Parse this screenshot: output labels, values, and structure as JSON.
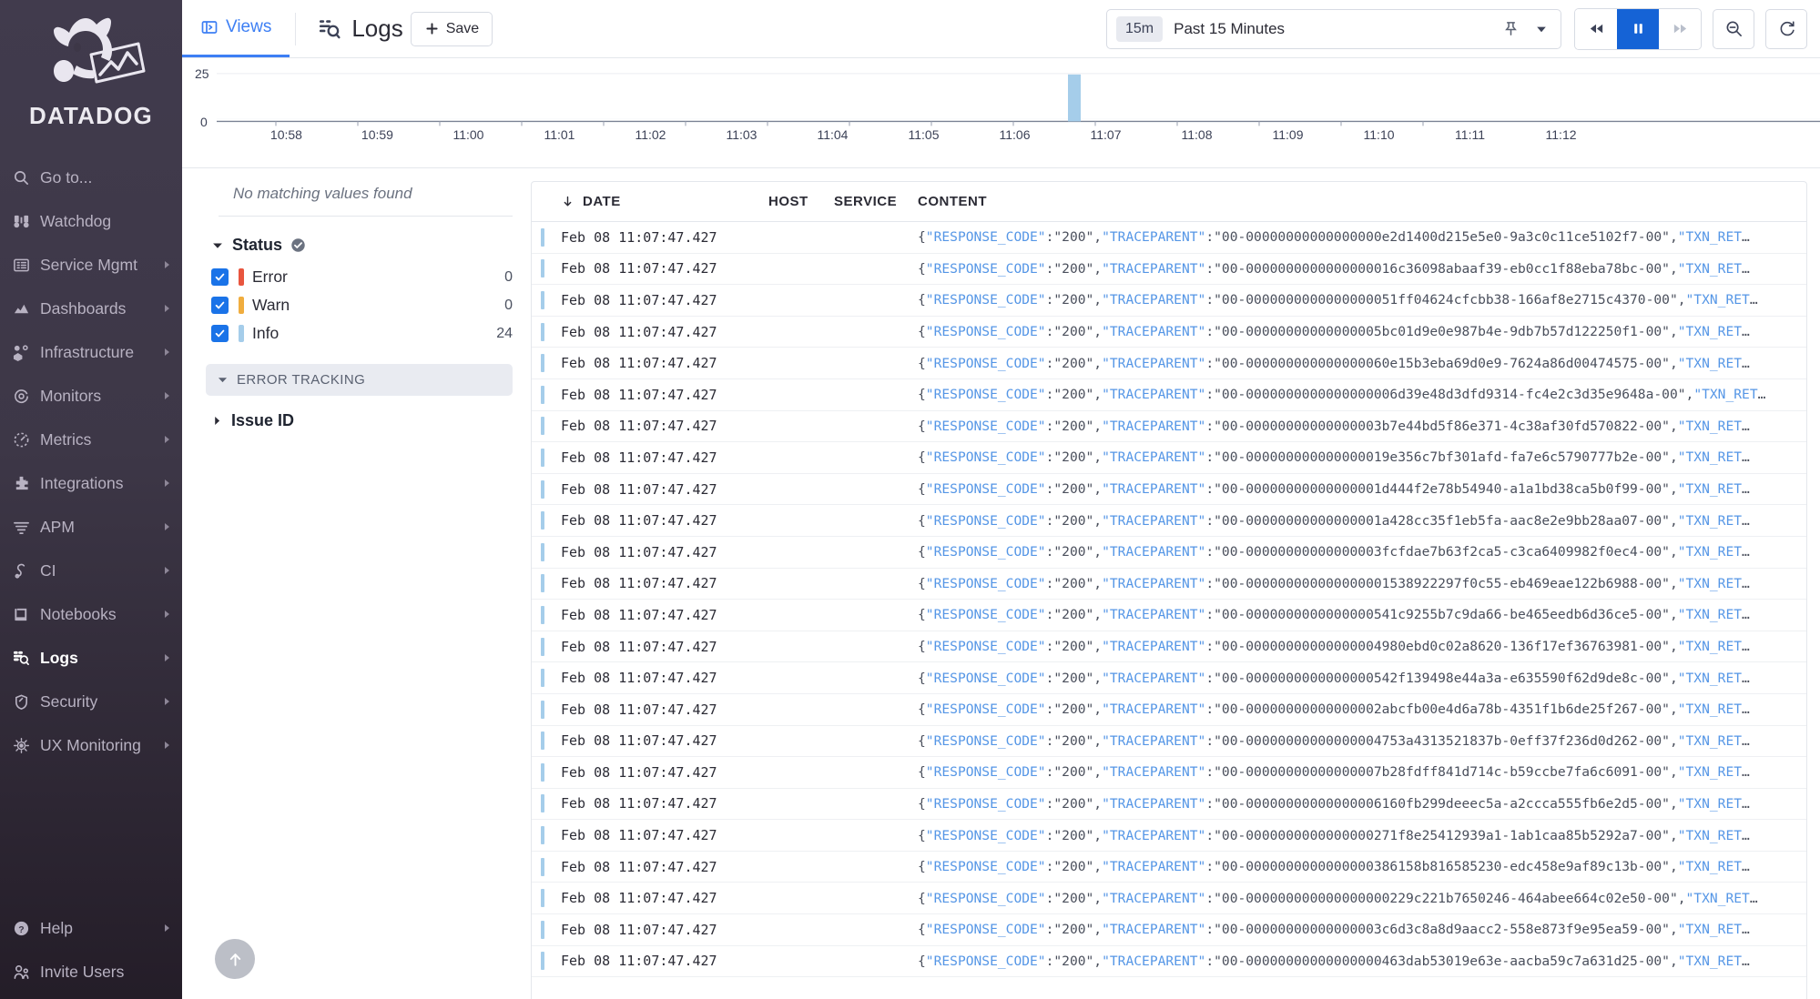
{
  "sidebar": {
    "brand": "DATADOG",
    "items": [
      {
        "label": "Go to...",
        "icon": "search-icon",
        "caret": false,
        "active": false
      },
      {
        "label": "Watchdog",
        "icon": "binoculars-icon",
        "caret": false,
        "active": false
      },
      {
        "label": "Service Mgmt",
        "icon": "list-icon",
        "caret": true,
        "active": false
      },
      {
        "label": "Dashboards",
        "icon": "chart-area-icon",
        "caret": true,
        "active": false
      },
      {
        "label": "Infrastructure",
        "icon": "nodes-icon",
        "caret": true,
        "active": false
      },
      {
        "label": "Monitors",
        "icon": "target-icon",
        "caret": true,
        "active": false
      },
      {
        "label": "Metrics",
        "icon": "gauge-icon",
        "caret": true,
        "active": false
      },
      {
        "label": "Integrations",
        "icon": "puzzle-icon",
        "caret": true,
        "active": false
      },
      {
        "label": "APM",
        "icon": "filter-lines-icon",
        "caret": true,
        "active": false
      },
      {
        "label": "CI",
        "icon": "pipeline-icon",
        "caret": true,
        "active": false
      },
      {
        "label": "Notebooks",
        "icon": "notebook-icon",
        "caret": true,
        "active": false
      },
      {
        "label": "Logs",
        "icon": "logs-search-icon",
        "caret": true,
        "active": true
      },
      {
        "label": "Security",
        "icon": "shield-icon",
        "caret": true,
        "active": false
      },
      {
        "label": "UX Monitoring",
        "icon": "ux-globe-icon",
        "caret": true,
        "active": false
      }
    ],
    "bottom_items": [
      {
        "label": "Help",
        "icon": "help-icon",
        "caret": true,
        "active": false
      },
      {
        "label": "Invite Users",
        "icon": "invite-users-icon",
        "caret": false,
        "active": false
      }
    ]
  },
  "topbar": {
    "views_tab": "Views",
    "page_title": "Logs",
    "save_label": "Save",
    "time_badge": "15m",
    "time_label": "Past 15 Minutes",
    "playback": {
      "rewind": "rewind-icon",
      "pause": "pause-icon",
      "forward": "forward-icon",
      "active": "pause"
    },
    "zoom_out": "zoom-out-icon",
    "refresh": "refresh-icon",
    "pin": "pin-icon",
    "chevron": "chevron-down-icon"
  },
  "facets": {
    "no_match_text": "No matching values found",
    "status": {
      "title": "Status",
      "badge": "check-circle-icon",
      "expanded": true,
      "values": [
        {
          "label": "Error",
          "count": "0",
          "color": "#e8553e",
          "checked": true
        },
        {
          "label": "Warn",
          "count": "0",
          "color": "#f0ad3e",
          "checked": true
        },
        {
          "label": "Info",
          "count": "24",
          "color": "#a5cdea",
          "checked": true
        }
      ]
    },
    "group": {
      "label": "ERROR TRACKING",
      "expanded": true
    },
    "issue_id": {
      "label": "Issue ID",
      "expanded": false
    },
    "scroll_top": "arrow-up-icon"
  },
  "table": {
    "columns": [
      "DATE",
      "HOST",
      "SERVICE",
      "CONTENT"
    ],
    "sort_icon": "sort-desc-arrow-icon",
    "rows": [
      {
        "date": "Feb 08 11:07:47.427",
        "host": "",
        "service": "",
        "status_color": "#a5cdea",
        "trace": "00-00000000000000000e2d1400d215e5e0-9a3c0c11ce5102f7-00"
      },
      {
        "date": "Feb 08 11:07:47.427",
        "host": "",
        "service": "",
        "status_color": "#a5cdea",
        "trace": "00-0000000000000000016c36098abaaf39-eb0cc1f88eba78bc-00"
      },
      {
        "date": "Feb 08 11:07:47.427",
        "host": "",
        "service": "",
        "status_color": "#a5cdea",
        "trace": "00-0000000000000000051ff04624cfcbb38-166af8e2715c4370-00"
      },
      {
        "date": "Feb 08 11:07:47.427",
        "host": "",
        "service": "",
        "status_color": "#a5cdea",
        "trace": "00-00000000000000005bc01d9e0e987b4e-9db7b57d122250f1-00"
      },
      {
        "date": "Feb 08 11:07:47.427",
        "host": "",
        "service": "",
        "status_color": "#a5cdea",
        "trace": "00-000000000000000060e15b3eba69d0e9-7624a86d00474575-00"
      },
      {
        "date": "Feb 08 11:07:47.427",
        "host": "",
        "service": "",
        "status_color": "#a5cdea",
        "trace": "00-0000000000000000006d39e48d3dfd9314-fc4e2c3d35e9648a-00"
      },
      {
        "date": "Feb 08 11:07:47.427",
        "host": "",
        "service": "",
        "status_color": "#a5cdea",
        "trace": "00-00000000000000003b7e44bd5f86e371-4c38af30fd570822-00"
      },
      {
        "date": "Feb 08 11:07:47.427",
        "host": "",
        "service": "",
        "status_color": "#a5cdea",
        "trace": "00-000000000000000019e356c7bf301afd-fa7e6c5790777b2e-00"
      },
      {
        "date": "Feb 08 11:07:47.427",
        "host": "",
        "service": "",
        "status_color": "#a5cdea",
        "trace": "00-00000000000000001d444f2e78b54940-a1a1bd38ca5b0f99-00"
      },
      {
        "date": "Feb 08 11:07:47.427",
        "host": "",
        "service": "",
        "status_color": "#a5cdea",
        "trace": "00-00000000000000001a428cc35f1eb5fa-aac8e2e9bb28aa07-00"
      },
      {
        "date": "Feb 08 11:07:47.427",
        "host": "",
        "service": "",
        "status_color": "#a5cdea",
        "trace": "00-00000000000000003fcfdae7b63f2ca5-c3ca6409982f0ec4-00"
      },
      {
        "date": "Feb 08 11:07:47.427",
        "host": "",
        "service": "",
        "status_color": "#a5cdea",
        "trace": "00-000000000000000001538922297f0c55-eb469eae122b6988-00"
      },
      {
        "date": "Feb 08 11:07:47.427",
        "host": "",
        "service": "",
        "status_color": "#a5cdea",
        "trace": "00-0000000000000000541c9255b7c9da66-be465eedb6d36ce5-00"
      },
      {
        "date": "Feb 08 11:07:47.427",
        "host": "",
        "service": "",
        "status_color": "#a5cdea",
        "trace": "00-00000000000000004980ebd0c02a8620-136f17ef36763981-00"
      },
      {
        "date": "Feb 08 11:07:47.427",
        "host": "",
        "service": "",
        "status_color": "#a5cdea",
        "trace": "00-0000000000000000542f139498e44a3a-e635590f62d9de8c-00"
      },
      {
        "date": "Feb 08 11:07:47.427",
        "host": "",
        "service": "",
        "status_color": "#a5cdea",
        "trace": "00-00000000000000002abcfb00e4d6a78b-4351f1b6de25f267-00"
      },
      {
        "date": "Feb 08 11:07:47.427",
        "host": "",
        "service": "",
        "status_color": "#a5cdea",
        "trace": "00-00000000000000004753a4313521837b-0eff37f236d0d262-00"
      },
      {
        "date": "Feb 08 11:07:47.427",
        "host": "",
        "service": "",
        "status_color": "#a5cdea",
        "trace": "00-00000000000000007b28fdff841d714c-b59ccbe7fa6c6091-00"
      },
      {
        "date": "Feb 08 11:07:47.427",
        "host": "",
        "service": "",
        "status_color": "#a5cdea",
        "trace": "00-00000000000000006160fb299deeec5a-a2ccca555fb6e2d5-00"
      },
      {
        "date": "Feb 08 11:07:47.427",
        "host": "",
        "service": "",
        "status_color": "#a5cdea",
        "trace": "00-0000000000000000271f8e25412939a1-1ab1caa85b5292a7-00"
      },
      {
        "date": "Feb 08 11:07:47.427",
        "host": "",
        "service": "",
        "status_color": "#a5cdea",
        "trace": "00-0000000000000000386158b816585230-edc458e9af89c13b-00"
      },
      {
        "date": "Feb 08 11:07:47.427",
        "host": "",
        "service": "",
        "status_color": "#a5cdea",
        "trace": "00-000000000000000000229c221b7650246-464abee664c02e50-00"
      },
      {
        "date": "Feb 08 11:07:47.427",
        "host": "",
        "service": "",
        "status_color": "#a5cdea",
        "trace": "00-00000000000000003c6d3c8a8d9aacc2-558e873f9e95ea59-00"
      },
      {
        "date": "Feb 08 11:07:47.427",
        "host": "",
        "service": "",
        "status_color": "#a5cdea",
        "trace": "00-00000000000000000463dab53019e63e-aacba59c7a631d25-00"
      }
    ],
    "content_prefix_key": "RESPONSE_CODE",
    "content_code_value": "200",
    "content_trace_key": "TRACEPARENT",
    "content_tail_key": "TXN_RET"
  },
  "chart_data": {
    "type": "bar",
    "title": "",
    "xlabel": "",
    "ylabel": "",
    "ylim": [
      0,
      25
    ],
    "yticks": [
      "0",
      "25"
    ],
    "grid": true,
    "legend": false,
    "bar_color": "#a5cdea",
    "categories": [
      "10:58",
      "10:59",
      "11:00",
      "11:01",
      "11:02",
      "11:03",
      "11:04",
      "11:05",
      "11:06",
      "11:07",
      "11:08",
      "11:09",
      "11:10",
      "11:11",
      "11:12"
    ],
    "series": [
      {
        "name": "Info",
        "values": [
          0,
          0,
          0,
          0,
          0,
          0,
          0,
          0,
          0,
          0,
          0,
          0,
          0,
          0,
          0
        ]
      }
    ],
    "bars": [
      {
        "x": "11:07:47",
        "value": 24
      }
    ]
  }
}
